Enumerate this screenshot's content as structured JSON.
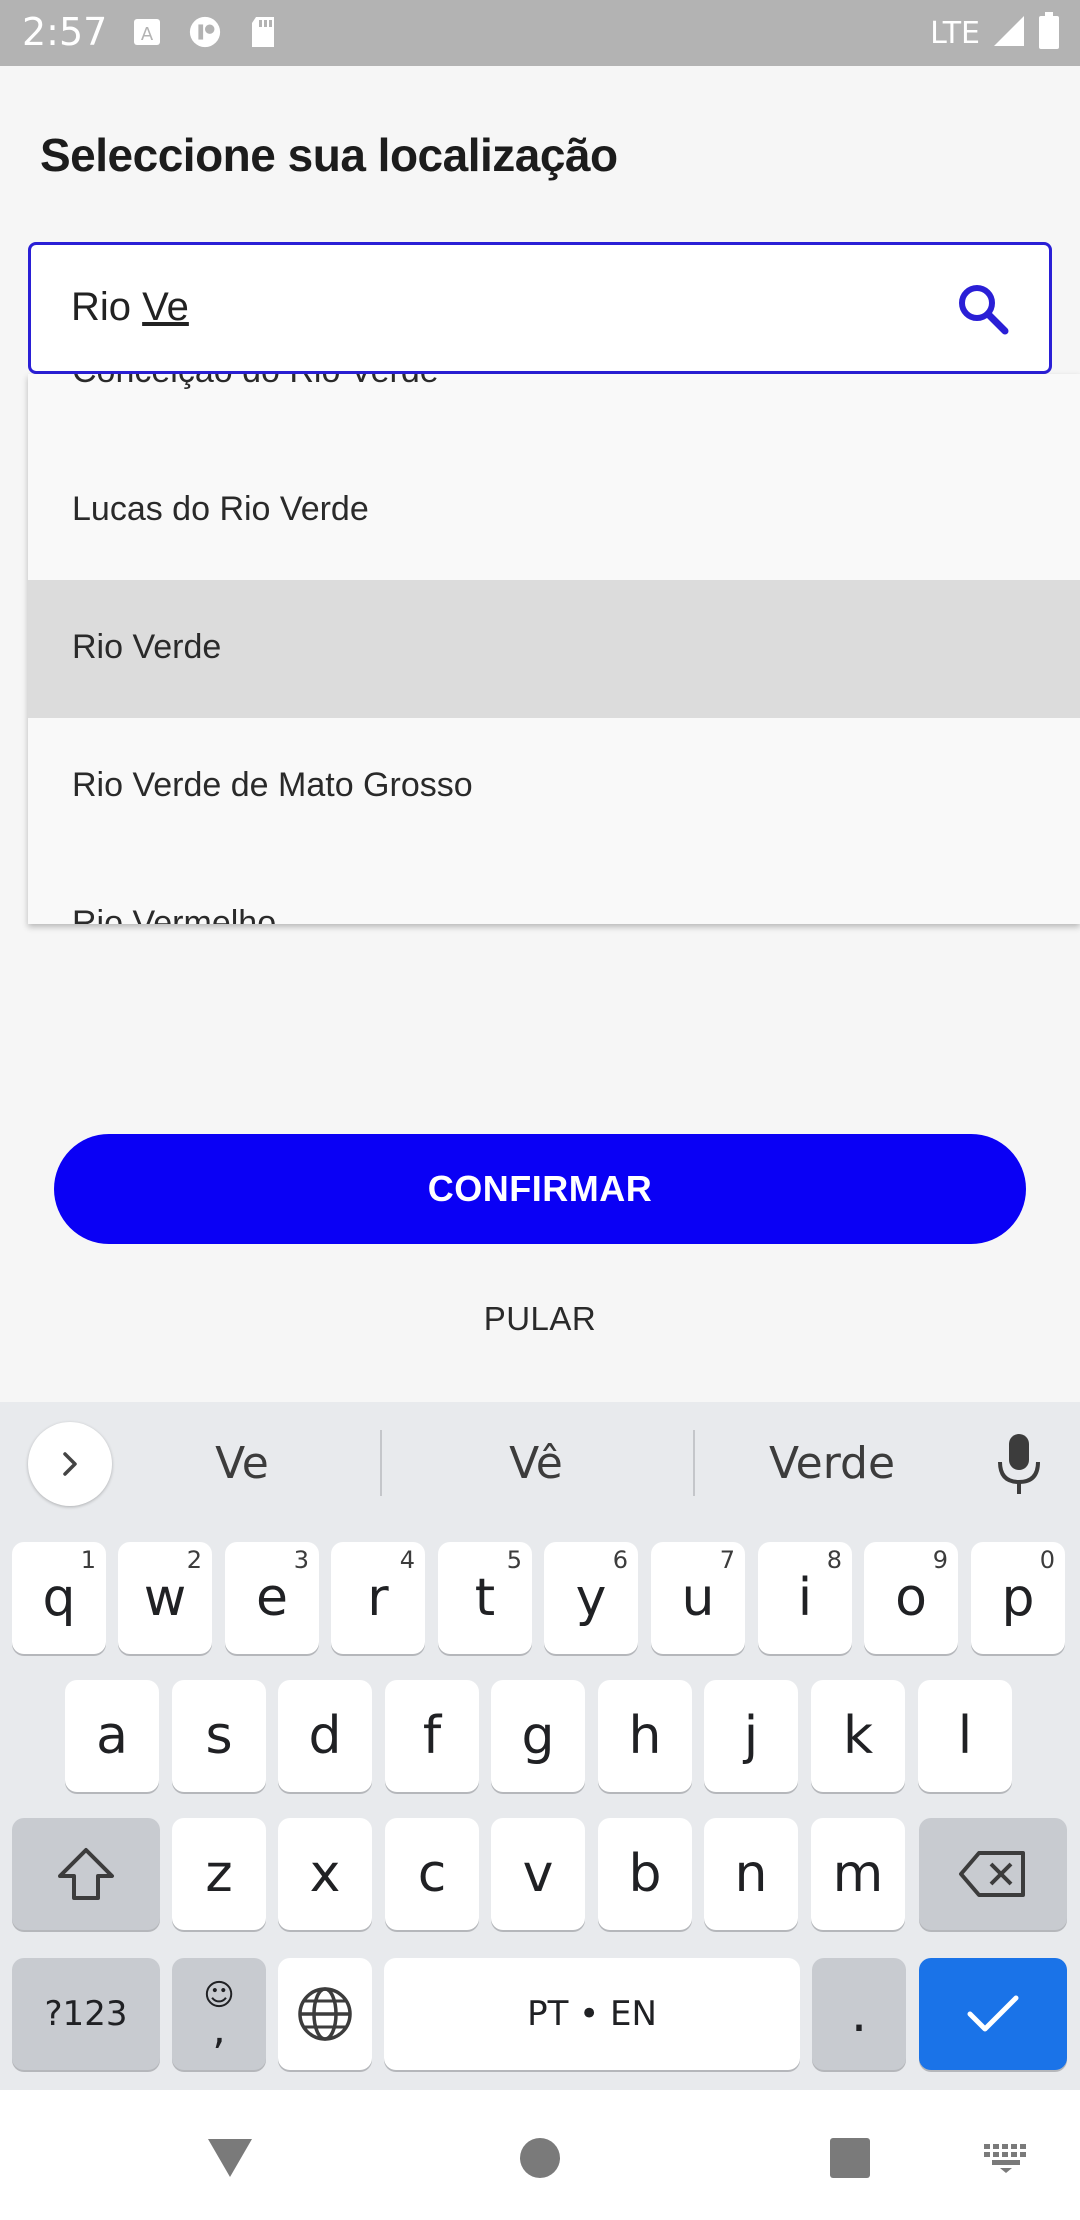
{
  "status_bar": {
    "time": "2:57",
    "network": "LTE",
    "icons": [
      "font-icon",
      "app-icon",
      "sd-card-icon",
      "signal-icon",
      "battery-icon"
    ]
  },
  "page": {
    "title": "Seleccione sua localização"
  },
  "search": {
    "value_prefix": "Rio ",
    "value_typed": "Ve",
    "icon": "search-icon",
    "accent_color": "#2a1fd6"
  },
  "dropdown": {
    "items": [
      {
        "label": "Conceição do Rio Verde",
        "selected": false
      },
      {
        "label": "Lucas do Rio Verde",
        "selected": false
      },
      {
        "label": "Rio Verde",
        "selected": true
      },
      {
        "label": "Rio Verde de Mato Grosso",
        "selected": false
      },
      {
        "label": "Rio Vermelho",
        "selected": false
      }
    ]
  },
  "actions": {
    "confirm_label": "CONFIRMAR",
    "skip_label": "PULAR",
    "confirm_color": "#0a00f5"
  },
  "keyboard": {
    "suggestions": [
      "Ve",
      "Vê",
      "Verde"
    ],
    "row1": [
      {
        "key": "q",
        "hint": "1"
      },
      {
        "key": "w",
        "hint": "2"
      },
      {
        "key": "e",
        "hint": "3"
      },
      {
        "key": "r",
        "hint": "4"
      },
      {
        "key": "t",
        "hint": "5"
      },
      {
        "key": "y",
        "hint": "6"
      },
      {
        "key": "u",
        "hint": "7"
      },
      {
        "key": "i",
        "hint": "8"
      },
      {
        "key": "o",
        "hint": "9"
      },
      {
        "key": "p",
        "hint": "0"
      }
    ],
    "row2": [
      "a",
      "s",
      "d",
      "f",
      "g",
      "h",
      "j",
      "k",
      "l"
    ],
    "row3": [
      "z",
      "x",
      "c",
      "v",
      "b",
      "n",
      "m"
    ],
    "symbols_label": "?123",
    "emoji_top": "☺",
    "comma_label": ",",
    "space_label": "PT • EN",
    "period_label": ".",
    "enter_color": "#1a73e8"
  },
  "nav_bar": {
    "items": [
      "back-icon",
      "home-icon",
      "recents-icon",
      "keyboard-icon"
    ]
  }
}
